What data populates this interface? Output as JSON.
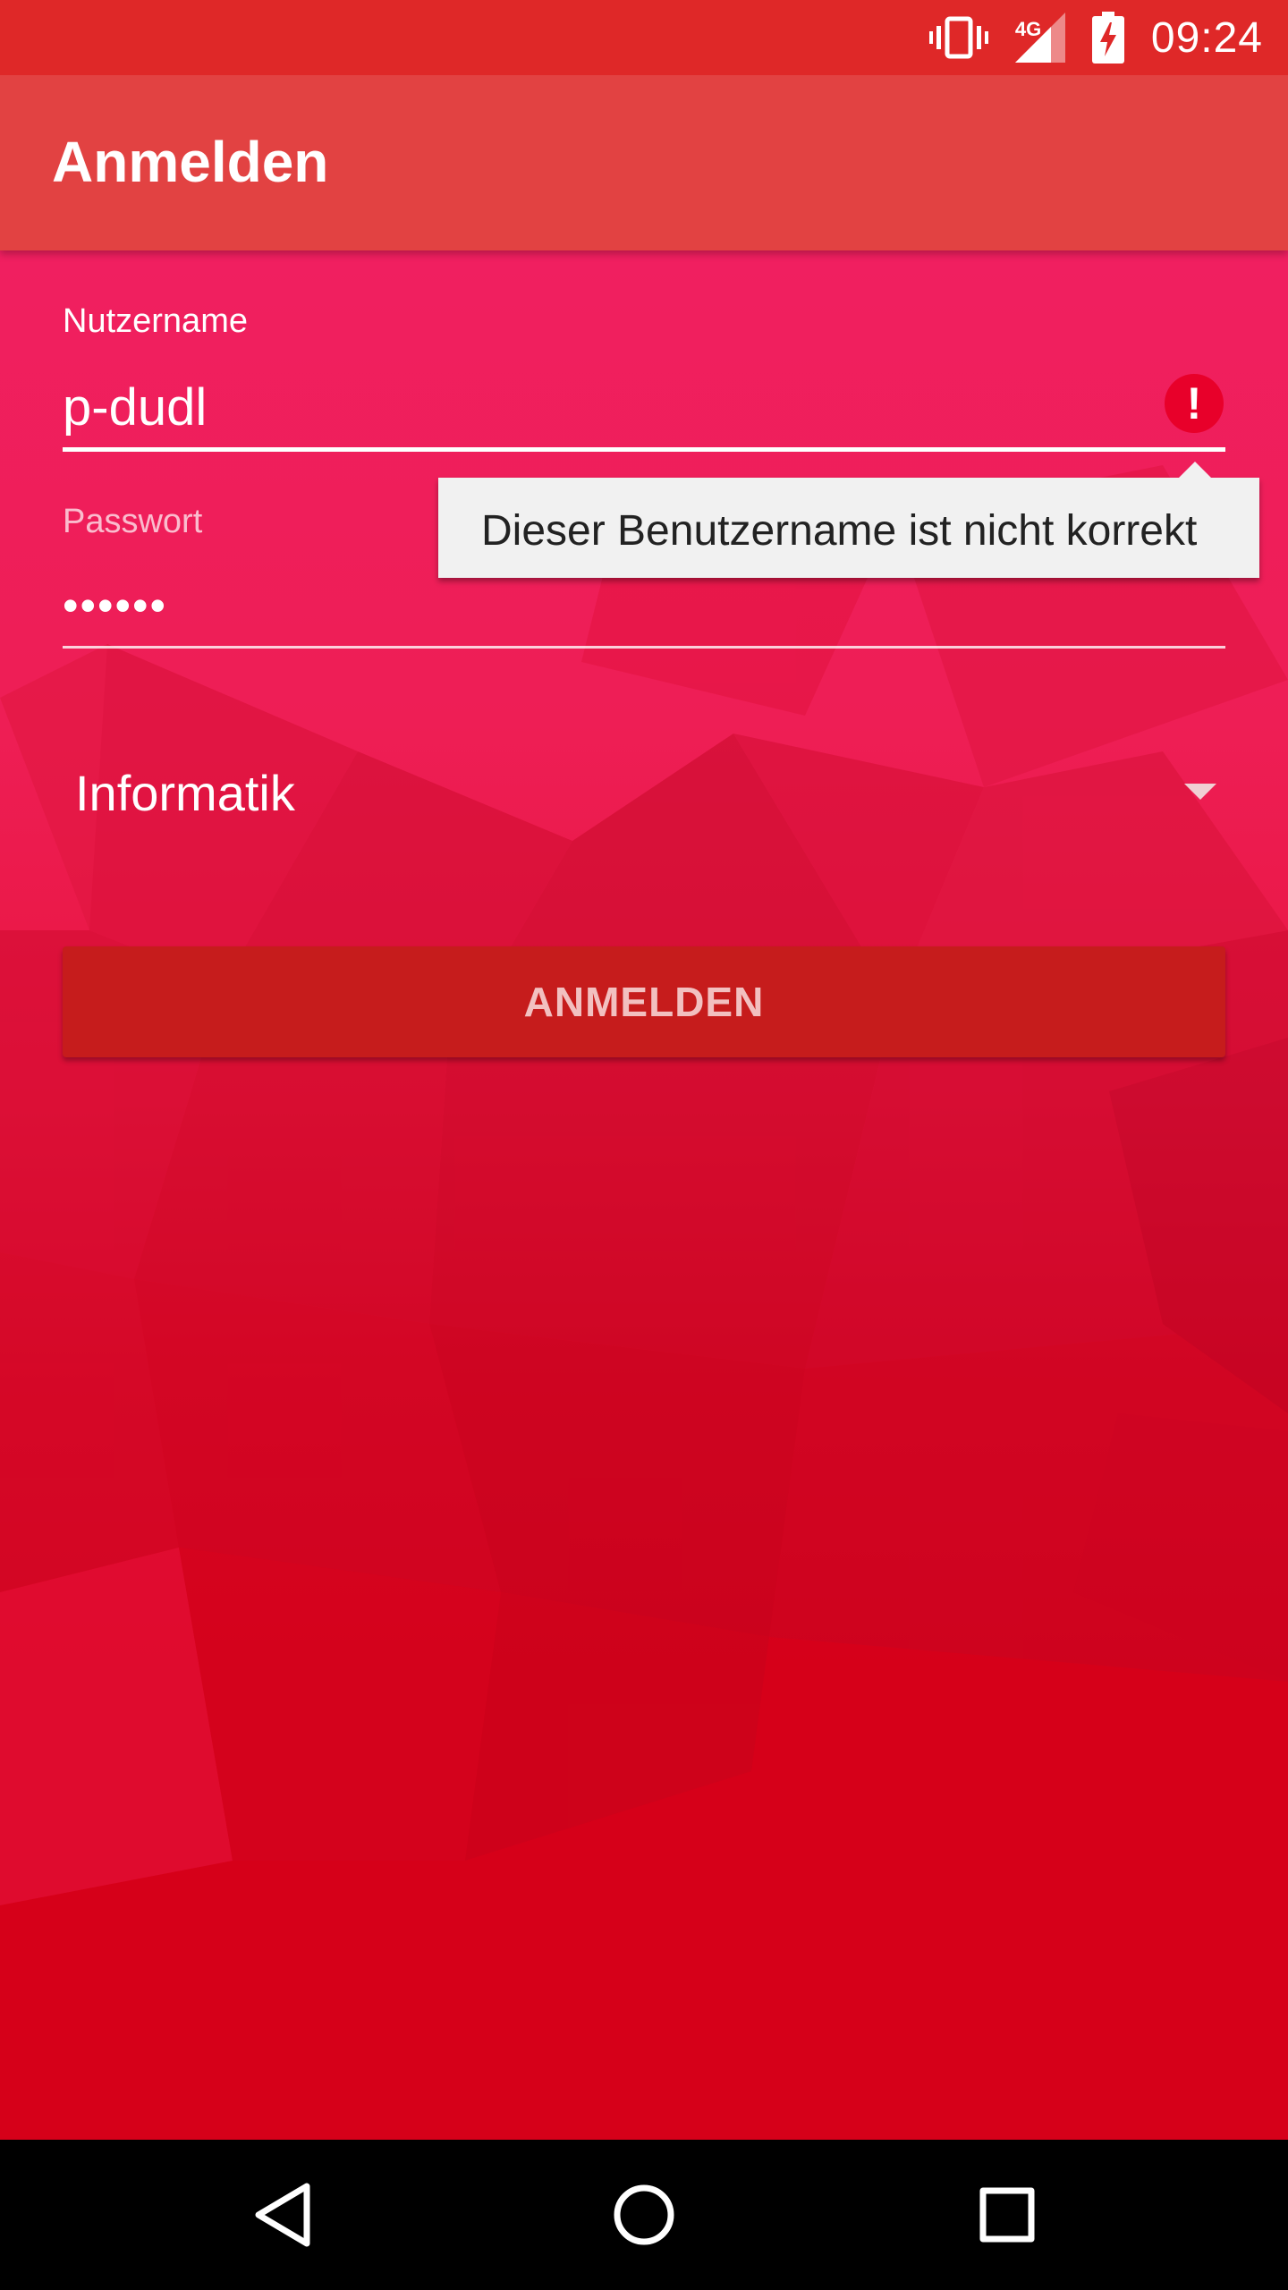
{
  "status_bar": {
    "time": "09:24",
    "network": "4G",
    "icons": [
      "vibrate-icon",
      "signal-icon",
      "battery-charging-icon"
    ]
  },
  "app_bar": {
    "title": "Anmelden"
  },
  "form": {
    "username": {
      "label": "Nutzername",
      "value": "p-dudl",
      "error": "Dieser Benutzername ist nicht korrekt"
    },
    "password": {
      "label": "Passwort",
      "value": "••••••"
    },
    "department": {
      "selected": "Informatik"
    },
    "submit_label": "ANMELDEN"
  },
  "nav_bar": {
    "icons": [
      "back-icon",
      "home-icon",
      "recents-icon"
    ]
  },
  "colors": {
    "status_bar": "#df2828",
    "app_bar": "#e24242",
    "background_top": "#f01f60",
    "background_bottom": "#d60019",
    "button": "#c61c1c",
    "error": "#e8002a"
  }
}
